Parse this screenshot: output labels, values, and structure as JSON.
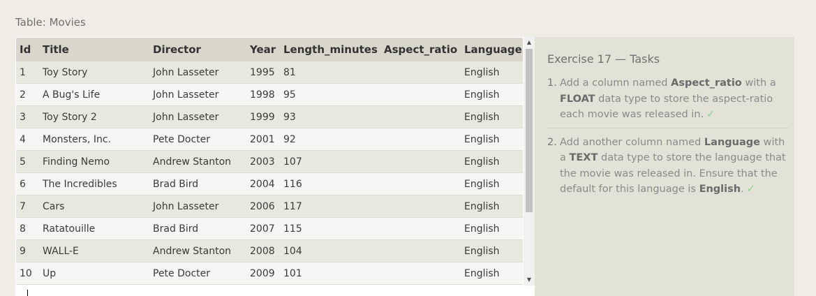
{
  "table": {
    "caption": "Table: Movies",
    "columns": [
      "Id",
      "Title",
      "Director",
      "Year",
      "Length_minutes",
      "Aspect_ratio",
      "Language"
    ],
    "rows": [
      [
        "1",
        "Toy Story",
        "John Lasseter",
        "1995",
        "81",
        "",
        "English"
      ],
      [
        "2",
        "A Bug's Life",
        "John Lasseter",
        "1998",
        "95",
        "",
        "English"
      ],
      [
        "3",
        "Toy Story 2",
        "John Lasseter",
        "1999",
        "93",
        "",
        "English"
      ],
      [
        "4",
        "Monsters, Inc.",
        "Pete Docter",
        "2001",
        "92",
        "",
        "English"
      ],
      [
        "5",
        "Finding Nemo",
        "Andrew Stanton",
        "2003",
        "107",
        "",
        "English"
      ],
      [
        "6",
        "The Incredibles",
        "Brad Bird",
        "2004",
        "116",
        "",
        "English"
      ],
      [
        "7",
        "Cars",
        "John Lasseter",
        "2006",
        "117",
        "",
        "English"
      ],
      [
        "8",
        "Ratatouille",
        "Brad Bird",
        "2007",
        "115",
        "",
        "English"
      ],
      [
        "9",
        "WALL-E",
        "Andrew Stanton",
        "2008",
        "104",
        "",
        "English"
      ],
      [
        "10",
        "Up",
        "Pete Docter",
        "2009",
        "101",
        "",
        "English"
      ]
    ],
    "scroll_up_glyph": "▲",
    "scroll_down_glyph": "▼"
  },
  "tasks": {
    "title": "Exercise 17 — Tasks",
    "check_glyph": "✓",
    "items": [
      {
        "num": "1.",
        "p1": "Add a column named ",
        "b1": "Aspect_ratio",
        "p2": " with a ",
        "b2": "FLOAT",
        "p3": " data type to store the aspect-ratio each movie was released in.",
        "b3": "",
        "p4": "",
        "done": true
      },
      {
        "num": "2.",
        "p1": "Add another column named ",
        "b1": "Language",
        "p2": " with a ",
        "b2": "TEXT",
        "p3": " data type to store the language that the movie was released in. Ensure that the default for this language is ",
        "b3": "English",
        "p4": ".",
        "done": true
      }
    ]
  }
}
